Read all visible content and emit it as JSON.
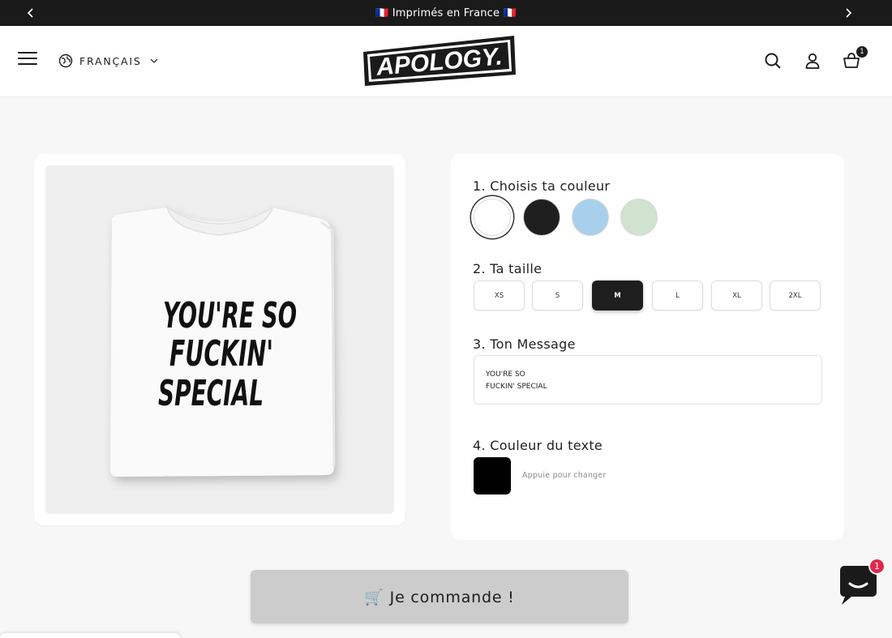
{
  "announcement": {
    "text": "🇫🇷 Imprimés en France 🇫🇷",
    "prev_icon": "chevron-left-icon",
    "next_icon": "chevron-right-icon"
  },
  "header": {
    "menu_icon": "hamburger-menu-icon",
    "language": "FRANÇAIS",
    "logo_text": "APOLOGY.",
    "search_icon": "search-icon",
    "account_icon": "user-icon",
    "cart_icon": "cart-icon",
    "cart_count": "1"
  },
  "product": {
    "shirt_text_lines": [
      "YOU'RE SO",
      "FUCKIN'",
      "SPECIAL"
    ],
    "shirt_color": "#ffffff",
    "print_color": "#111111"
  },
  "options": {
    "color_title": "1. Choisis ta couleur",
    "colors": [
      {
        "name": "white",
        "hex": "#ffffff",
        "selected": true
      },
      {
        "name": "black",
        "hex": "#1f1f1f",
        "selected": false
      },
      {
        "name": "light-blue",
        "hex": "#a8d0ec",
        "selected": false
      },
      {
        "name": "mint",
        "hex": "#cfe3cf",
        "selected": false
      }
    ],
    "size_title": "2. Ta taille",
    "sizes": [
      {
        "label": "XS",
        "active": false
      },
      {
        "label": "S",
        "active": false
      },
      {
        "label": "M",
        "active": true
      },
      {
        "label": "L",
        "active": false
      },
      {
        "label": "XL",
        "active": false
      },
      {
        "label": "2XL",
        "active": false
      }
    ],
    "message_title": "3. Ton Message",
    "message_value": "YOU'RE SO\nFUCKIN' SPECIAL",
    "text_color_title": "4. Couleur du texte",
    "text_color": "#000000",
    "text_color_hint": "Appuie pour changer"
  },
  "order_button": {
    "label": "🛒 Je commande !"
  },
  "chat": {
    "icon": "chat-icon",
    "badge": "1"
  }
}
